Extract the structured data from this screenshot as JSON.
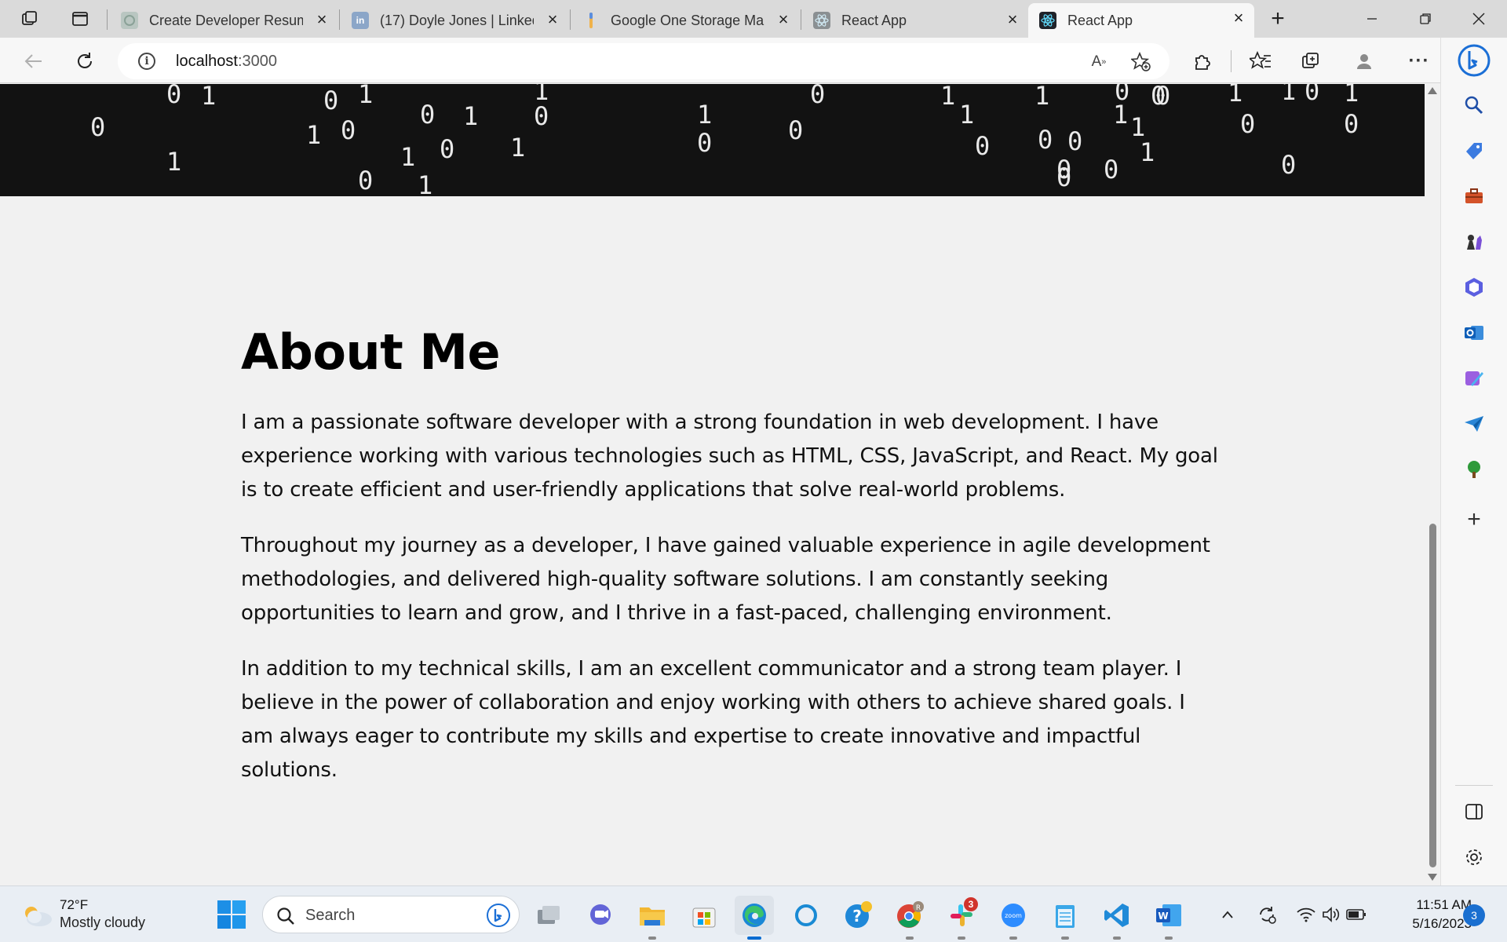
{
  "browser": {
    "tabs": [
      {
        "title": "Create Developer Resume",
        "favicon": "chatgpt-icon",
        "active": false
      },
      {
        "title": "(17) Doyle Jones | LinkedIn",
        "favicon": "linkedin-icon",
        "active": false
      },
      {
        "title": "Google One Storage Manager",
        "favicon": "google-one-icon",
        "active": false
      },
      {
        "title": "React App",
        "favicon": "react-icon",
        "active": false
      },
      {
        "title": "React App",
        "favicon": "react-icon",
        "active": true
      }
    ],
    "address": {
      "host": "localhost",
      "port": ":3000"
    }
  },
  "page": {
    "matrix_bits": [
      "0",
      "1",
      "0",
      "1",
      "0",
      "1",
      "1",
      "0",
      "0",
      "1",
      "0",
      "1",
      "0",
      "1",
      "1",
      "1",
      "0",
      "1",
      "0",
      "0",
      "0",
      "1",
      "1",
      "0",
      "1",
      "0",
      "0",
      "0",
      "0",
      "0",
      "0",
      "1",
      "1",
      "0",
      "0",
      "1",
      "0",
      "1",
      "0",
      "0",
      "1",
      "0",
      "1"
    ],
    "about": {
      "heading": "About Me",
      "paragraphs": [
        "I am a passionate software developer with a strong foundation in web development. I have experience working with various technologies such as HTML, CSS, JavaScript, and React. My goal is to create efficient and user-friendly applications that solve real-world problems.",
        "Throughout my journey as a developer, I have gained valuable experience in agile development methodologies, and delivered high-quality software solutions. I am constantly seeking opportunities to learn and grow, and I thrive in a fast-paced, challenging environment.",
        "In addition to my technical skills, I am an excellent communicator and a strong team player. I believe in the power of collaboration and enjoy working with others to achieve shared goals. I am always eager to contribute my skills and expertise to create innovative and impactful solutions."
      ]
    }
  },
  "sidebar_icons": [
    "search-icon",
    "tag-icon",
    "toolbox-icon",
    "chess-icon",
    "office-icon",
    "outlook-icon",
    "designer-icon",
    "send-icon",
    "tree-icon",
    "add-icon",
    "sidebar-layout-icon",
    "settings-icon"
  ],
  "taskbar": {
    "weather": {
      "temp": "72°F",
      "condition": "Mostly cloudy"
    },
    "search_placeholder": "Search",
    "slack_badge": "3",
    "clock": {
      "time": "11:51 AM",
      "date": "5/16/2023"
    },
    "notifications": "3",
    "colors": {
      "accent": "#0a6cd1",
      "taskbar_bg": "#e9eef4"
    }
  }
}
